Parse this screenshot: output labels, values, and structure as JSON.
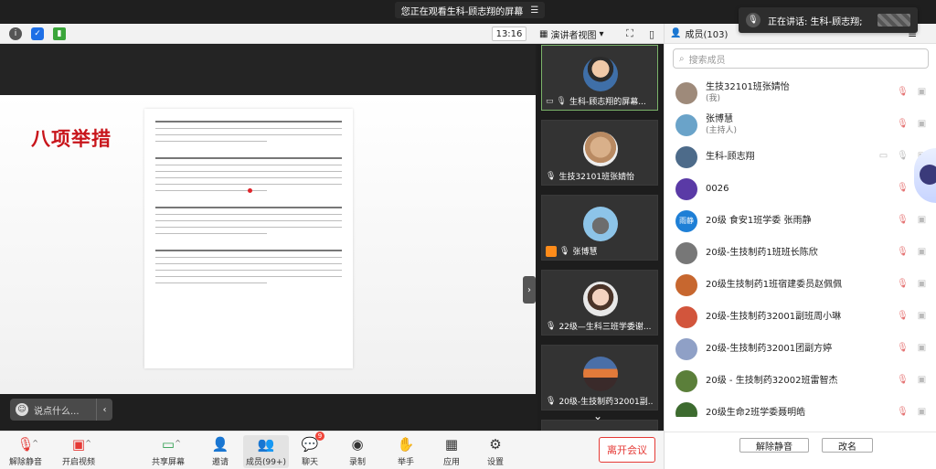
{
  "banner": {
    "text": "您正在观看生科-顾志翔的屏幕",
    "icon": "menu-icon"
  },
  "toast": {
    "text": "正在讲话: 生科-顾志翔;"
  },
  "topbar": {
    "time": "13:16",
    "view_mode": "演讲者视图",
    "members_label": "成员(103)"
  },
  "slide": {
    "title": "八项举措"
  },
  "comment": {
    "placeholder": "说点什么..."
  },
  "video_tiles": [
    {
      "name": "生科-顾志翔的屏幕...",
      "active": true
    },
    {
      "name": "生技32101班张婧怡",
      "active": false
    },
    {
      "name": "张博慧",
      "active": false
    },
    {
      "name": "22级—生科三班学委谢...",
      "active": false
    },
    {
      "name": "20级-生技制药32001副...",
      "active": false
    }
  ],
  "controls": {
    "unmute": "解除静音",
    "start_video": "开启视频",
    "share_screen": "共享屏幕",
    "invite": "邀请",
    "members": "成员(99+)",
    "chat": "聊天",
    "chat_badge": "9",
    "record": "录制",
    "raise_hand": "举手",
    "apps": "应用",
    "settings": "设置",
    "leave": "离开会议"
  },
  "panel": {
    "search_placeholder": "搜索成员",
    "members": [
      {
        "name": "生技32101班张婧怡",
        "sub": "(我)",
        "color": "#9e8a7a"
      },
      {
        "name": "张博慧",
        "sub": "(主持人)",
        "color": "#6aa3c9"
      },
      {
        "name": "生科-顾志翔",
        "sub": "",
        "color": "#4d6b8a"
      },
      {
        "name": "0026",
        "sub": "",
        "color": "#5a3aa6"
      },
      {
        "name": "20级 食安1班学委 张雨静",
        "sub": "",
        "color": "#1e7fd6",
        "initials": "雨静"
      },
      {
        "name": "20级-生技制药1班班长陈欣",
        "sub": "",
        "color": "#777777"
      },
      {
        "name": "20级生技制药1班宿建委员赵佩佩",
        "sub": "",
        "color": "#c7672f"
      },
      {
        "name": "20级-生技制药32001副班周小琳",
        "sub": "",
        "color": "#d2553c"
      },
      {
        "name": "20级-生技制药32001团副方婷",
        "sub": "",
        "color": "#8fa0c6"
      },
      {
        "name": "20级 - 生技制药32002班雷智杰",
        "sub": "",
        "color": "#5b7f3a"
      },
      {
        "name": "20级生命2班学委聂明皓",
        "sub": "",
        "color": "#3d6b2f"
      }
    ],
    "unmute_all": "解除静音",
    "rename": "改名"
  }
}
